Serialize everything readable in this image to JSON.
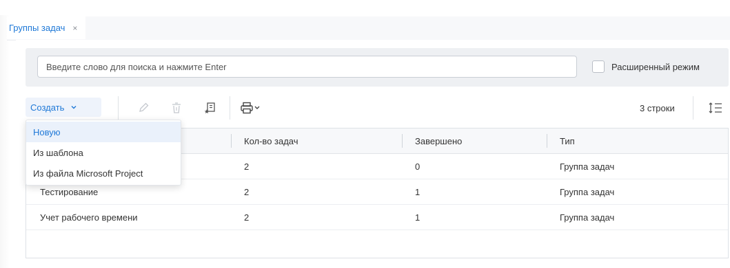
{
  "tab": {
    "label": "Группы задач",
    "close": "×"
  },
  "search": {
    "placeholder": "Введите слово для поиска и нажмите Enter",
    "value": "",
    "advanced_label": "Расширенный режим",
    "advanced_checked": false
  },
  "toolbar": {
    "create_label": "Создать",
    "create_icon": "chevron-down-icon",
    "edit_icon": "pencil-icon",
    "delete_icon": "trash-icon",
    "template_icon": "save-as-template-icon",
    "print_icon": "printer-icon",
    "rows_count": "3 строки",
    "density_icon": "row-height-icon"
  },
  "table": {
    "columns": [
      "",
      "Кол-во задач",
      "Завершено",
      "Тип"
    ],
    "rows": [
      {
        "name": "",
        "count": "2",
        "done": "0",
        "type": "Группа задач"
      },
      {
        "name": "Тестирование",
        "count": "2",
        "done": "1",
        "type": "Группа задач"
      },
      {
        "name": "Учет рабочего времени",
        "count": "2",
        "done": "1",
        "type": "Группа задач"
      }
    ]
  },
  "create_menu": {
    "items": [
      "Новую",
      "Из шаблона",
      "Из файла Microsoft Project"
    ],
    "active_index": 0
  },
  "colors": {
    "accent": "#1e78d7",
    "hover": "#eaf1fb",
    "search_bg": "#eef0f3"
  }
}
